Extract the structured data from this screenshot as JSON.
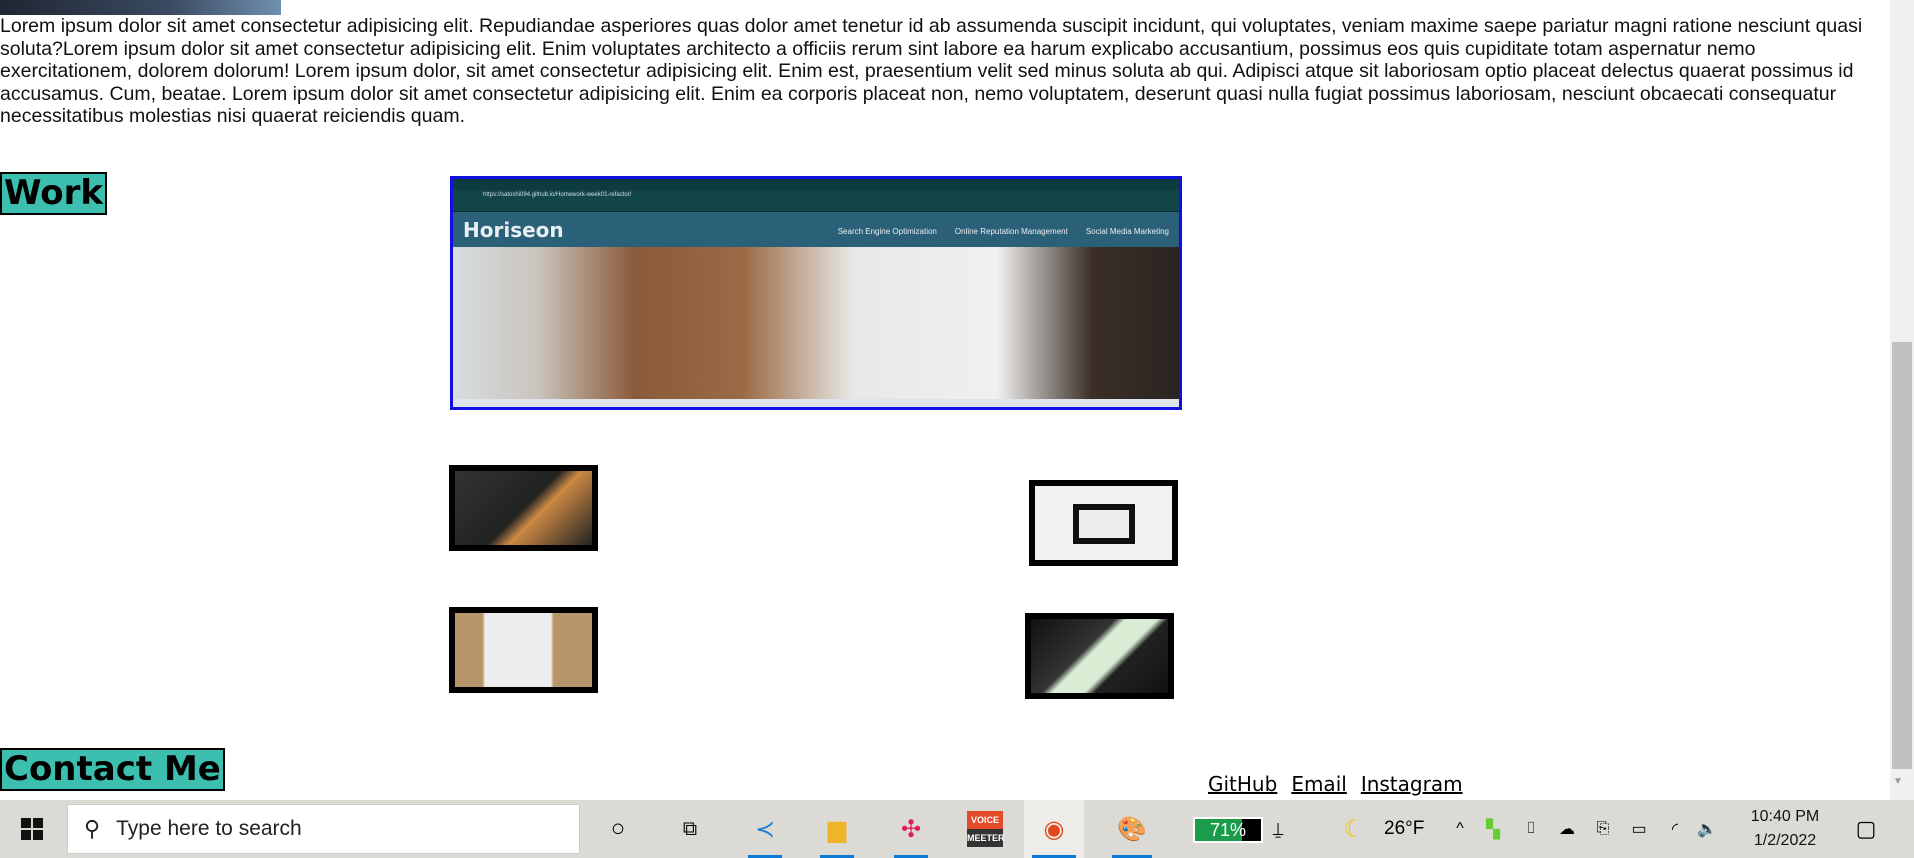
{
  "paragraph": "Lorem ipsum dolor sit amet consectetur adipisicing elit. Repudiandae asperiores quas dolor amet tenetur id ab assumenda suscipit incidunt, qui voluptates, veniam maxime saepe pariatur magni ratione nesciunt quasi soluta?Lorem ipsum dolor sit amet consectetur adipisicing elit. Enim voluptates architecto a officiis rerum sint labore ea harum explicabo accusantium, possimus eos quis cupiditate totam aspernatur nemo exercitationem, dolorem dolorum! Lorem ipsum dolor, sit amet consectetur adipisicing elit. Enim est, praesentium velit sed minus soluta ab qui. Adipisci atque sit laboriosam optio placeat delectus quaerat possimus id accusamus. Cum, beatae. Lorem ipsum dolor sit amet consectetur adipisicing elit. Enim ea corporis placeat non, nemo voluptatem, deserunt quasi nulla fugiat possimus laboriosam, nesciunt obcaecati consequatur necessitatibus molestias nisi quaerat reiciendis quam.",
  "work_heading": "Work",
  "contact_heading": "Contact Me",
  "screenshot": {
    "url": "https://satoshi094.github.io/Homework-week01-refactor/",
    "brand": "Horiseon",
    "nav": [
      "Search Engine Optimization",
      "Online Reputation Management",
      "Social Media Marketing"
    ]
  },
  "links": [
    "GitHub",
    "Email",
    "Instagram"
  ],
  "taskbar": {
    "search_placeholder": "Type here to search",
    "battery": "71%",
    "battery_level": 71,
    "temperature": "26°F",
    "time": "10:40 PM",
    "date": "1/2/2022",
    "voicemeeter": "VOICE MEETER"
  }
}
